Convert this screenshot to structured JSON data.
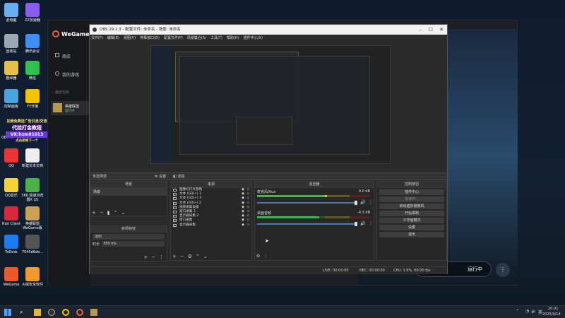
{
  "desktop": {
    "icons": [
      {
        "label": "此电脑",
        "color": "#6ab0f0"
      },
      {
        "label": "ZZ加速器",
        "color": "#8a5cf0"
      },
      {
        "label": "回收站",
        "color": "#9aa7b5"
      },
      {
        "label": "腾讯会议",
        "color": "#3f8cf2"
      },
      {
        "label": "翻译器",
        "color": "#e7c04a"
      },
      {
        "label": "微信",
        "color": "#2ec24b"
      },
      {
        "label": "控制面板",
        "color": "#4aa3df"
      },
      {
        "label": "YY开播",
        "color": "#f5c400"
      },
      {
        "label": "QQ",
        "color": "#e33"
      },
      {
        "label": "新建文本文档",
        "color": "#eee"
      },
      {
        "label": "QQ音乐",
        "color": "#f6d23a"
      },
      {
        "label": "360 极速浏览器X (2)",
        "color": "#4db04a"
      },
      {
        "label": "Riot Client",
        "color": "#d8283b"
      },
      {
        "label": "英雄联盟WeGame版",
        "color": "#caa052"
      },
      {
        "label": "ToDesk",
        "color": "#1b7cf0"
      },
      {
        "label": "7045d6de...",
        "color": "#555"
      },
      {
        "label": "WeGame",
        "color": "#e85a2a"
      },
      {
        "label": "火绒安全软件",
        "color": "#f29a2e"
      }
    ],
    "obs_icon_label": "OBS S",
    "watermark": {
      "line1": "加我免费送广告引流/交流",
      "line2": "代挂打金教程",
      "line3": "VX:hzm81013",
      "line4": "点击拒绝下一个"
    }
  },
  "wegame": {
    "logo": "WeGame",
    "nav": [
      "商店",
      "我的游戏"
    ],
    "recent_label": "最近在玩",
    "game_name": "英雄联盟",
    "game_status": "运行中",
    "running_button": "运行中"
  },
  "obs": {
    "title": "OBS 29.1.3 - 配置文件: 未命名 - 场景: 未命名",
    "menu": [
      "文件(F)",
      "编辑(E)",
      "视图(V)",
      "停靠窗口(D)",
      "配置文件(P)",
      "场景集合(S)",
      "工具(T)",
      "帮助(H)",
      "插件中心(X)"
    ],
    "context_bar": {
      "no_source": "未选择源",
      "properties": "设置",
      "filters": "滤镜"
    },
    "scenes": {
      "header": "场景",
      "items": [
        "场景"
      ]
    },
    "sources": {
      "header": "来源",
      "items": [
        "图像幻灯片放映",
        "文本 (GDI+) 3",
        "文本 (GDI+) 3",
        "文本 (GDI+) 2",
        "视频采集设备",
        "窗口采集 2",
        "显示器采集 2",
        "窗口采集",
        "显示器采集"
      ]
    },
    "transitions": {
      "header": "转场特效",
      "type": "淡出",
      "duration_label": "时长",
      "duration_value": "350 ms"
    },
    "mixer": {
      "header": "混音器",
      "channels": [
        {
          "name": "麦克风/Aux",
          "db": "0.0 dB",
          "level": 0.62
        },
        {
          "name": "桌面音频",
          "db": "-4.3 dB",
          "level": 0.55
        }
      ],
      "ticks": [
        "-60",
        "-55",
        "-50",
        "-45",
        "-40",
        "-35",
        "-30",
        "-25",
        "-20",
        "-15",
        "-10",
        "-5",
        "0"
      ]
    },
    "controls": {
      "header": "控制按钮",
      "buttons": [
        "插件中心",
        "连接中...",
        "启动虚拟摄像机",
        "开始录制",
        "工作室模式",
        "设置",
        "退出"
      ]
    },
    "status": {
      "live": "LIVE: 00:00:00",
      "rec": "REC: 00:00:00",
      "cpu": "CPU: 1.6%, 60.00 fps"
    }
  },
  "taskbar": {
    "time": "20:01",
    "date": "2025/9/14",
    "lang": "英"
  },
  "colors": {
    "accent": "#2a5a8a",
    "meter_green": "#4caf50",
    "meter_yellow": "#d8c93a",
    "meter_red": "#c0392b"
  }
}
